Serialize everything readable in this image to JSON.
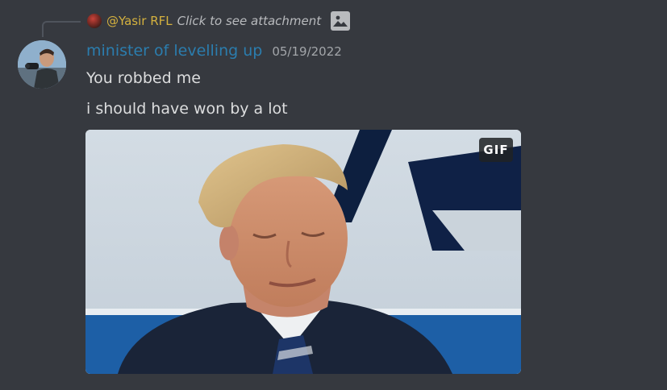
{
  "reply": {
    "username": "@Yasir RFL",
    "text": "Click to see attachment",
    "avatar_icon": "user-avatar",
    "attachment_icon": "image-icon",
    "name_color": "#d4b13f"
  },
  "message": {
    "author": "minister of levelling up",
    "author_color": "#2b7dae",
    "timestamp": "05/19/2022",
    "lines": [
      "You robbed me",
      "i should have won by a lot"
    ]
  },
  "embed": {
    "badge": "GIF"
  }
}
